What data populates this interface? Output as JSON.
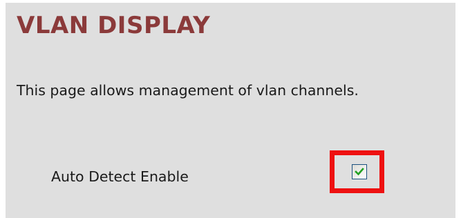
{
  "page": {
    "title": "VLAN DISPLAY",
    "description": "This page allows management of vlan channels."
  },
  "settings": {
    "auto_detect": {
      "label": "Auto Detect Enable",
      "checked": true
    }
  },
  "colors": {
    "title": "#8b3a3a",
    "panel_background": "#dfdfdf",
    "highlight": "#ee1111",
    "checkmark": "#21a121"
  },
  "icons": {
    "checkmark": "checkmark-icon"
  }
}
